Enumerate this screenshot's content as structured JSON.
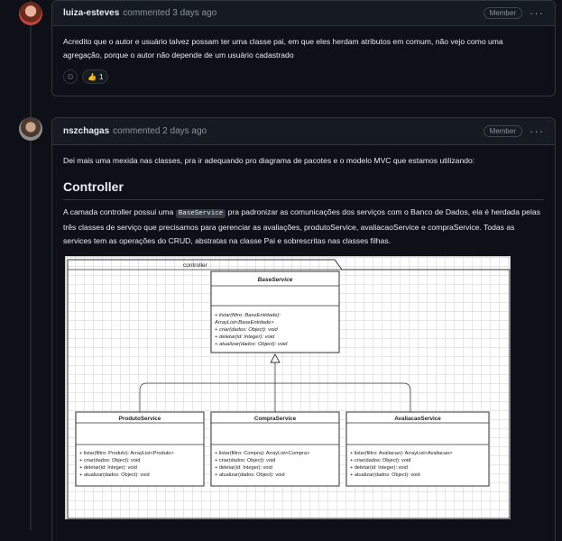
{
  "comment1": {
    "author": "luiza-esteves",
    "meta": "commented 3 days ago",
    "badge": "Member",
    "body": "Acredito que o autor e usuário talvez possam ter uma classe pai, em que eles herdam atributos em comum, não vejo como uma agregação, porque o autor não depende de um usuário cadastrado",
    "reaction_emoji": "👍",
    "reaction_count": "1"
  },
  "comment2": {
    "author": "nszchagas",
    "meta": "commented 2 days ago",
    "badge": "Member",
    "intro": "Dei mais uma mexida nas classes, pra ir adequando pro diagrama de pacotes e o modelo MVC que estamos utilizando:",
    "heading": "Controller",
    "para_part1": "A camada controller possui uma ",
    "para_code": "BaseService",
    "para_part2": " pra padronizar as comunicações dos serviços com o Banco de Dados, ela é herdada pelas três classes de serviço que precisamos para gerenciar as avaliações, produtoService, avaliacaoService e compraService. Todas as services tem as operações do CRUD, abstratas na classe Pai e sobrescritas nas classes filhas."
  },
  "diagram": {
    "package": "controller",
    "base": {
      "name": "BaseService",
      "methods": [
        "+ listar(filtro: BaseEntidade):",
        "ArrayList<BaseEntidade>",
        "+ criar(dados: Object): void",
        "+ deletar(id: Integer): void",
        "+ atualizar(dados: Object): void"
      ]
    },
    "children": [
      {
        "name": "ProdutoService",
        "methods": [
          "+ listar(filtro: Produto): ArrayList<Produto>",
          "+ criar(dados: Object): void",
          "+ deletar(id: Integer): void",
          "+ atualizar(dados: Object): void"
        ]
      },
      {
        "name": "CompraService",
        "methods": [
          "+ listar(filtro: Compra): ArrayList<Compra>",
          "+ criar(dados: Object): void",
          "+ deletar(id: Integer): void",
          "+ atualizar(dados: Object): void"
        ]
      },
      {
        "name": "AvaliacaoService",
        "methods": [
          "+ listar(filtro: Avaliacao): ArrayList<Avaliacao>",
          "+ criar(dados: Object): void",
          "+ deletar(id: Integer): void",
          "+ atualizar(dados: Object): void"
        ]
      }
    ]
  }
}
